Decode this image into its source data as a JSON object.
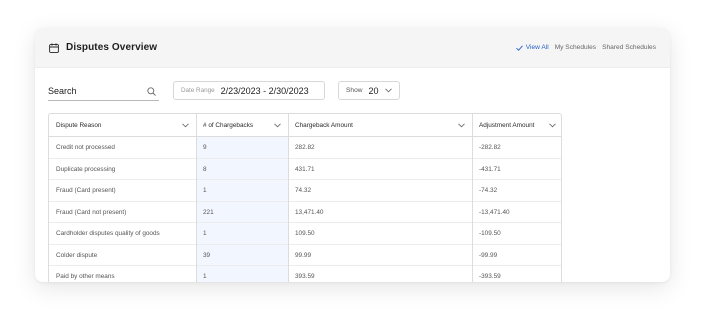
{
  "header": {
    "title": "Disputes Overview",
    "links": [
      "View All",
      "My Schedules",
      "Shared Schedules"
    ],
    "active_link": "View All"
  },
  "filters": {
    "search_label": "Search",
    "date_range_label": "Date Range",
    "date_range_value": "2/23/2023 - 2/30/2023",
    "show_label": "Show",
    "show_value": "20"
  },
  "table": {
    "columns": [
      "Dispute Reason",
      "# of Chargebacks",
      "Chargeback Amount",
      "Adjustment Amount"
    ],
    "rows": [
      [
        "Credit not processed",
        "9",
        "282.82",
        "-282.82"
      ],
      [
        "Duplicate processing",
        "8",
        "431.71",
        "-431.71"
      ],
      [
        "Fraud (Card present)",
        "1",
        "74.32",
        "-74.32"
      ],
      [
        "Fraud (Card not present)",
        "221",
        "13,471.40",
        "-13,471.40"
      ],
      [
        "Cardholder disputes quality of goods",
        "1",
        "109.50",
        "-109.50"
      ],
      [
        "Colder dispute",
        "39",
        "99.99",
        "-99.99"
      ],
      [
        "Paid by other means",
        "1",
        "393.59",
        "-393.59"
      ]
    ]
  },
  "colors": {
    "accent": "#2a62c8",
    "header_bg": "#f5f5f6",
    "highlight_column": "#f2f6ff"
  },
  "icons": [
    "calendar-icon",
    "check-icon",
    "search-icon",
    "chevron-down-icon"
  ]
}
